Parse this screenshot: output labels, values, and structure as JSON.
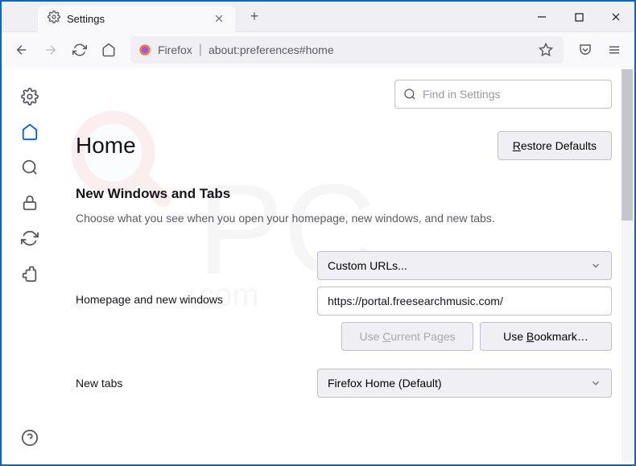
{
  "tab": {
    "title": "Settings"
  },
  "urlbar": {
    "identity": "Firefox",
    "url": "about:preferences#home"
  },
  "search": {
    "placeholder": "Find in Settings"
  },
  "page": {
    "heading": "Home",
    "restore_btn": "Restore Defaults",
    "section_title": "New Windows and Tabs",
    "section_desc": "Choose what you see when you open your homepage, new windows, and new tabs."
  },
  "homepage": {
    "label": "Homepage and new windows",
    "select_value": "Custom URLs...",
    "url_value": "https://portal.freesearchmusic.com/",
    "use_current": "Use Current Pages",
    "use_bookmark": "Use Bookmark…"
  },
  "newtabs": {
    "label": "New tabs",
    "select_value": "Firefox Home (Default)"
  }
}
